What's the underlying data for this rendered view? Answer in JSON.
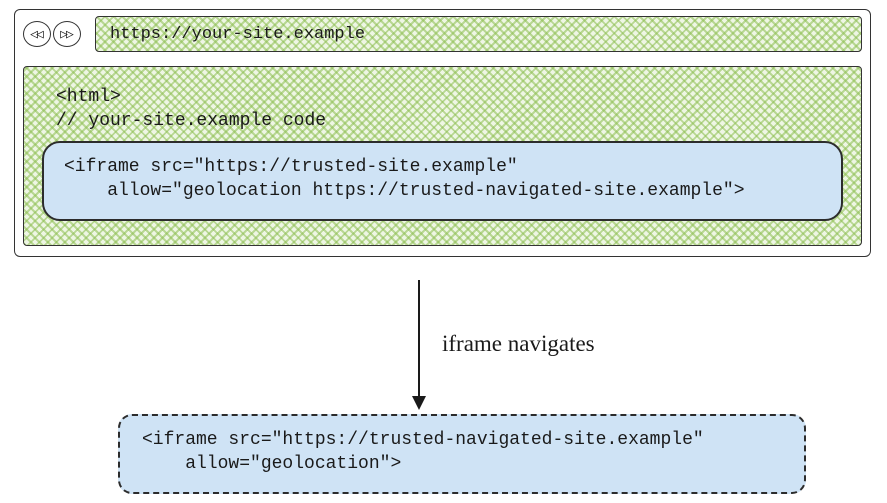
{
  "browser": {
    "back_glyph": "◁◁",
    "fwd_glyph": "▷▷",
    "url": "https://your-site.example"
  },
  "page_code": {
    "line1": "<html>",
    "line2": "// your-site.example code"
  },
  "iframe_before": {
    "line1": "<iframe src=\"https://trusted-site.example\"",
    "line2": "    allow=\"geolocation https://trusted-navigated-site.example\">"
  },
  "arrow_label": "iframe navigates",
  "iframe_after": {
    "line1": "<iframe src=\"https://trusted-navigated-site.example\"",
    "line2": "    allow=\"geolocation\">"
  }
}
